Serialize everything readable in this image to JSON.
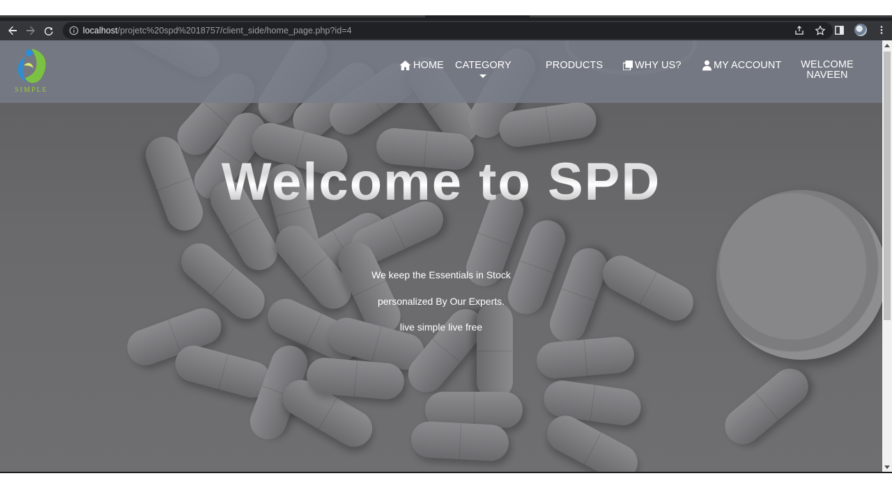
{
  "browser": {
    "url_host": "localhost",
    "url_path": "/projetc%20spd%2018757/client_side/home_page.php?id=4"
  },
  "site": {
    "logo_text": "SIMPLE",
    "nav": {
      "home": "HOME",
      "category": "CATEGORY",
      "products": "PRODUCTS",
      "why_us": "WHY US?",
      "my_account": "MY ACCOUNT",
      "welcome_line1": "WELCOME",
      "welcome_line2": "NAVEEN"
    }
  },
  "hero": {
    "title": "Welcome to SPD",
    "line1": "We keep the Essentials in Stock",
    "line2": "personalized By Our Experts.",
    "line3": "live simple live free"
  },
  "colors": {
    "toolbar": "#35363a",
    "omnibox": "#202124",
    "header_overlay": "#787c88",
    "logo_green": "#9acd32",
    "logo_blue": "#1e90ff"
  },
  "icons": {
    "back": "arrow-left-icon",
    "forward": "arrow-right-icon",
    "reload": "reload-icon",
    "site_info": "info-icon",
    "share": "share-icon",
    "bookmark": "star-icon",
    "side_panel": "side-panel-icon",
    "profile": "avatar",
    "menu": "kebab-menu-icon",
    "home": "home-icon",
    "why_us": "copy-icon",
    "account": "user-icon"
  }
}
